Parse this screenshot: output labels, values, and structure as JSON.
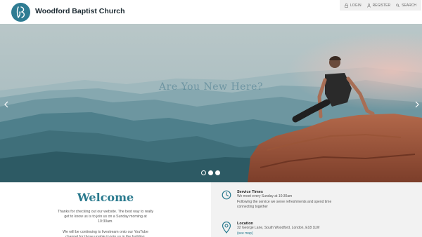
{
  "header": {
    "site_title": "Woodford Baptist Church",
    "nav": [
      {
        "label": "LOGIN",
        "icon": "lock-icon"
      },
      {
        "label": "REGISTER",
        "icon": "user-icon"
      },
      {
        "label": "SEARCH",
        "icon": "search-icon"
      }
    ]
  },
  "hero": {
    "caption": "Are You New Here?",
    "slides": 3,
    "active_slide": 2
  },
  "welcome": {
    "title": "Welcome",
    "paragraph_1": "Thanks for checking out our website. The best way to really get to know us is to join us on a Sunday morning at 10:30am.",
    "paragraph_2": "We will be continuing to livestream onto our YouTube channel for those unable to join us in the building."
  },
  "info": {
    "service_times": {
      "heading": "Service Times",
      "line_1": "We meet every Sunday at 10:30am",
      "line_2": "Following the service we serve refreshments and spend time connecting together",
      "icon": "clock-icon"
    },
    "location": {
      "heading": "Location",
      "line_1": "32 George Lane, South Woodford, London, E18 1LW",
      "link": "(see map)",
      "icon": "map-pin-icon"
    }
  },
  "colors": {
    "accent": "#2a7a8e",
    "logo": "#2f7c93",
    "panel": "#f2f2f2"
  }
}
